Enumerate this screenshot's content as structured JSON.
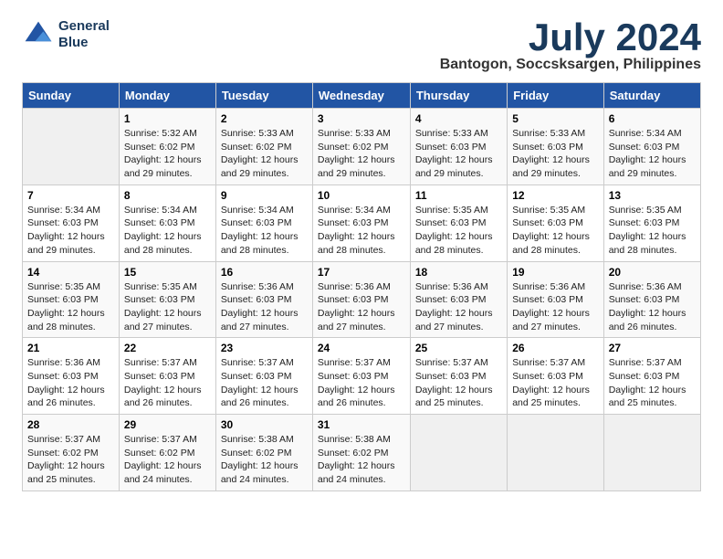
{
  "header": {
    "logo_line1": "General",
    "logo_line2": "Blue",
    "month_title": "July 2024",
    "subtitle": "Bantogon, Soccsksargen, Philippines"
  },
  "calendar": {
    "days_of_week": [
      "Sunday",
      "Monday",
      "Tuesday",
      "Wednesday",
      "Thursday",
      "Friday",
      "Saturday"
    ],
    "weeks": [
      [
        {
          "day": "",
          "info": ""
        },
        {
          "day": "1",
          "info": "Sunrise: 5:32 AM\nSunset: 6:02 PM\nDaylight: 12 hours\nand 29 minutes."
        },
        {
          "day": "2",
          "info": "Sunrise: 5:33 AM\nSunset: 6:02 PM\nDaylight: 12 hours\nand 29 minutes."
        },
        {
          "day": "3",
          "info": "Sunrise: 5:33 AM\nSunset: 6:02 PM\nDaylight: 12 hours\nand 29 minutes."
        },
        {
          "day": "4",
          "info": "Sunrise: 5:33 AM\nSunset: 6:03 PM\nDaylight: 12 hours\nand 29 minutes."
        },
        {
          "day": "5",
          "info": "Sunrise: 5:33 AM\nSunset: 6:03 PM\nDaylight: 12 hours\nand 29 minutes."
        },
        {
          "day": "6",
          "info": "Sunrise: 5:34 AM\nSunset: 6:03 PM\nDaylight: 12 hours\nand 29 minutes."
        }
      ],
      [
        {
          "day": "7",
          "info": "Sunrise: 5:34 AM\nSunset: 6:03 PM\nDaylight: 12 hours\nand 29 minutes."
        },
        {
          "day": "8",
          "info": "Sunrise: 5:34 AM\nSunset: 6:03 PM\nDaylight: 12 hours\nand 28 minutes."
        },
        {
          "day": "9",
          "info": "Sunrise: 5:34 AM\nSunset: 6:03 PM\nDaylight: 12 hours\nand 28 minutes."
        },
        {
          "day": "10",
          "info": "Sunrise: 5:34 AM\nSunset: 6:03 PM\nDaylight: 12 hours\nand 28 minutes."
        },
        {
          "day": "11",
          "info": "Sunrise: 5:35 AM\nSunset: 6:03 PM\nDaylight: 12 hours\nand 28 minutes."
        },
        {
          "day": "12",
          "info": "Sunrise: 5:35 AM\nSunset: 6:03 PM\nDaylight: 12 hours\nand 28 minutes."
        },
        {
          "day": "13",
          "info": "Sunrise: 5:35 AM\nSunset: 6:03 PM\nDaylight: 12 hours\nand 28 minutes."
        }
      ],
      [
        {
          "day": "14",
          "info": "Sunrise: 5:35 AM\nSunset: 6:03 PM\nDaylight: 12 hours\nand 28 minutes."
        },
        {
          "day": "15",
          "info": "Sunrise: 5:35 AM\nSunset: 6:03 PM\nDaylight: 12 hours\nand 27 minutes."
        },
        {
          "day": "16",
          "info": "Sunrise: 5:36 AM\nSunset: 6:03 PM\nDaylight: 12 hours\nand 27 minutes."
        },
        {
          "day": "17",
          "info": "Sunrise: 5:36 AM\nSunset: 6:03 PM\nDaylight: 12 hours\nand 27 minutes."
        },
        {
          "day": "18",
          "info": "Sunrise: 5:36 AM\nSunset: 6:03 PM\nDaylight: 12 hours\nand 27 minutes."
        },
        {
          "day": "19",
          "info": "Sunrise: 5:36 AM\nSunset: 6:03 PM\nDaylight: 12 hours\nand 27 minutes."
        },
        {
          "day": "20",
          "info": "Sunrise: 5:36 AM\nSunset: 6:03 PM\nDaylight: 12 hours\nand 26 minutes."
        }
      ],
      [
        {
          "day": "21",
          "info": "Sunrise: 5:36 AM\nSunset: 6:03 PM\nDaylight: 12 hours\nand 26 minutes."
        },
        {
          "day": "22",
          "info": "Sunrise: 5:37 AM\nSunset: 6:03 PM\nDaylight: 12 hours\nand 26 minutes."
        },
        {
          "day": "23",
          "info": "Sunrise: 5:37 AM\nSunset: 6:03 PM\nDaylight: 12 hours\nand 26 minutes."
        },
        {
          "day": "24",
          "info": "Sunrise: 5:37 AM\nSunset: 6:03 PM\nDaylight: 12 hours\nand 26 minutes."
        },
        {
          "day": "25",
          "info": "Sunrise: 5:37 AM\nSunset: 6:03 PM\nDaylight: 12 hours\nand 25 minutes."
        },
        {
          "day": "26",
          "info": "Sunrise: 5:37 AM\nSunset: 6:03 PM\nDaylight: 12 hours\nand 25 minutes."
        },
        {
          "day": "27",
          "info": "Sunrise: 5:37 AM\nSunset: 6:03 PM\nDaylight: 12 hours\nand 25 minutes."
        }
      ],
      [
        {
          "day": "28",
          "info": "Sunrise: 5:37 AM\nSunset: 6:02 PM\nDaylight: 12 hours\nand 25 minutes."
        },
        {
          "day": "29",
          "info": "Sunrise: 5:37 AM\nSunset: 6:02 PM\nDaylight: 12 hours\nand 24 minutes."
        },
        {
          "day": "30",
          "info": "Sunrise: 5:38 AM\nSunset: 6:02 PM\nDaylight: 12 hours\nand 24 minutes."
        },
        {
          "day": "31",
          "info": "Sunrise: 5:38 AM\nSunset: 6:02 PM\nDaylight: 12 hours\nand 24 minutes."
        },
        {
          "day": "",
          "info": ""
        },
        {
          "day": "",
          "info": ""
        },
        {
          "day": "",
          "info": ""
        }
      ]
    ]
  }
}
